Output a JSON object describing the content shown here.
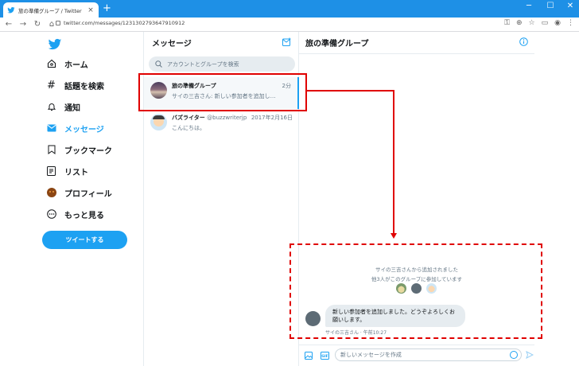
{
  "browser": {
    "tab_title": "旅の準備グループ / Twitter",
    "url": "twitter.com/messages/1231302793647910912",
    "new_tab": "+",
    "tab_close": "×"
  },
  "nav": {
    "items": [
      {
        "label": "ホーム",
        "icon": "home-icon"
      },
      {
        "label": "話題を検索",
        "icon": "hashtag-icon"
      },
      {
        "label": "通知",
        "icon": "bell-icon"
      },
      {
        "label": "メッセージ",
        "icon": "mail-icon",
        "active": true
      },
      {
        "label": "ブックマーク",
        "icon": "bookmark-icon"
      },
      {
        "label": "リスト",
        "icon": "list-icon"
      },
      {
        "label": "プロフィール",
        "icon": "avatar-icon"
      },
      {
        "label": "もっと見る",
        "icon": "more-icon"
      }
    ],
    "tweet_button": "ツイートする"
  },
  "messages": {
    "title": "メッセージ",
    "search_placeholder": "アカウントとグループを検索",
    "conversations": [
      {
        "name": "旅の準備グループ",
        "handle": "",
        "time": "2分",
        "preview": "サイの三吉さん: 新しい参加者を追加し…"
      },
      {
        "name": "バズライター",
        "handle": "@buzzwriterjp",
        "time": "2017年2月16日",
        "preview": "こんにちは。"
      }
    ]
  },
  "conversation": {
    "title": "旅の準備グループ",
    "system_added": "サイの三吉さんから追加されました",
    "system_joined": "他3人がこのグループに参加しています",
    "message_text": "新しい参加者を追加しました。どうぞよろしくお願いします。",
    "message_meta": "サイの三吉さん · 午前10:27",
    "input_placeholder": "新しいメッセージを作成"
  },
  "colors": {
    "accent": "#1da1f2",
    "annotation": "#e00000"
  }
}
